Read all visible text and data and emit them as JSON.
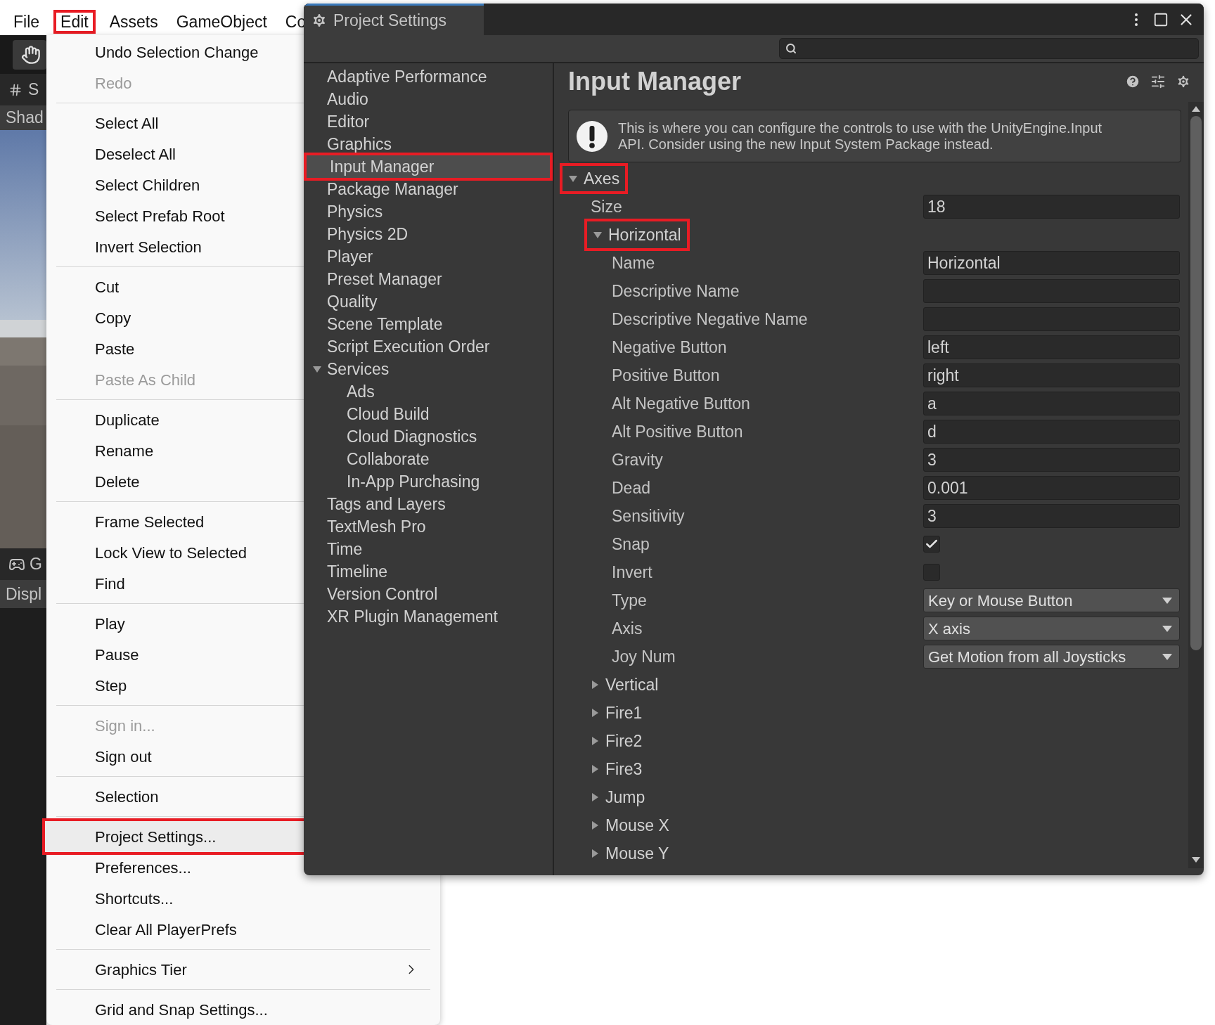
{
  "menu_bar": [
    {
      "label": "File",
      "highlighted": false
    },
    {
      "label": "Edit",
      "highlighted": true
    },
    {
      "label": "Assets",
      "highlighted": false
    },
    {
      "label": "GameObject",
      "highlighted": false
    },
    {
      "label": "Co",
      "highlighted": false
    }
  ],
  "editor_strip": {
    "scene_tab": "S",
    "scene_label": "Shad",
    "game_tab": "G",
    "game_label": "Displ"
  },
  "edit_menu": [
    [
      {
        "label": "Undo Selection Change",
        "kind": "command",
        "disabled": false,
        "highlighted": false
      },
      {
        "label": "Redo",
        "kind": "command",
        "disabled": true,
        "highlighted": false
      }
    ],
    [
      {
        "label": "Select All",
        "kind": "command",
        "disabled": false,
        "highlighted": false
      },
      {
        "label": "Deselect All",
        "kind": "command",
        "disabled": false,
        "highlighted": false
      },
      {
        "label": "Select Children",
        "kind": "command",
        "disabled": false,
        "highlighted": false
      },
      {
        "label": "Select Prefab Root",
        "kind": "command",
        "disabled": false,
        "highlighted": false
      },
      {
        "label": "Invert Selection",
        "kind": "command",
        "disabled": false,
        "highlighted": false
      }
    ],
    [
      {
        "label": "Cut",
        "kind": "command",
        "disabled": false,
        "highlighted": false
      },
      {
        "label": "Copy",
        "kind": "command",
        "disabled": false,
        "highlighted": false
      },
      {
        "label": "Paste",
        "kind": "command",
        "disabled": false,
        "highlighted": false
      },
      {
        "label": "Paste As Child",
        "kind": "command",
        "disabled": true,
        "highlighted": false
      }
    ],
    [
      {
        "label": "Duplicate",
        "kind": "command",
        "disabled": false,
        "highlighted": false
      },
      {
        "label": "Rename",
        "kind": "command",
        "disabled": false,
        "highlighted": false
      },
      {
        "label": "Delete",
        "kind": "command",
        "disabled": false,
        "highlighted": false
      }
    ],
    [
      {
        "label": "Frame Selected",
        "kind": "command",
        "disabled": false,
        "highlighted": false
      },
      {
        "label": "Lock View to Selected",
        "kind": "command",
        "disabled": false,
        "highlighted": false
      },
      {
        "label": "Find",
        "kind": "command",
        "disabled": false,
        "highlighted": false
      }
    ],
    [
      {
        "label": "Play",
        "kind": "command",
        "disabled": false,
        "highlighted": false
      },
      {
        "label": "Pause",
        "kind": "command",
        "disabled": false,
        "highlighted": false
      },
      {
        "label": "Step",
        "kind": "command",
        "disabled": false,
        "highlighted": false
      }
    ],
    [
      {
        "label": "Sign in...",
        "kind": "command",
        "disabled": true,
        "highlighted": false
      },
      {
        "label": "Sign out",
        "kind": "command",
        "disabled": false,
        "highlighted": false
      }
    ],
    [
      {
        "label": "Selection",
        "kind": "command",
        "disabled": false,
        "highlighted": false
      }
    ],
    [
      {
        "label": "Project Settings...",
        "kind": "command",
        "disabled": false,
        "highlighted": true
      },
      {
        "label": "Preferences...",
        "kind": "command",
        "disabled": false,
        "highlighted": false
      },
      {
        "label": "Shortcuts...",
        "kind": "command",
        "disabled": false,
        "highlighted": false
      },
      {
        "label": "Clear All PlayerPrefs",
        "kind": "command",
        "disabled": false,
        "highlighted": false
      }
    ],
    [
      {
        "label": "Graphics Tier",
        "kind": "submenu",
        "disabled": false,
        "highlighted": false
      }
    ],
    [
      {
        "label": "Grid and Snap Settings...",
        "kind": "command",
        "disabled": false,
        "highlighted": false
      }
    ]
  ],
  "window": {
    "title": "Project Settings"
  },
  "sidebar": {
    "items": [
      {
        "label": "Adaptive Performance",
        "selected": false,
        "highlighted": false
      },
      {
        "label": "Audio",
        "selected": false,
        "highlighted": false
      },
      {
        "label": "Editor",
        "selected": false,
        "highlighted": false
      },
      {
        "label": "Graphics",
        "selected": false,
        "highlighted": false
      },
      {
        "label": "Input Manager",
        "selected": true,
        "highlighted": true
      },
      {
        "label": "Package Manager",
        "selected": false,
        "highlighted": false
      },
      {
        "label": "Physics",
        "selected": false,
        "highlighted": false
      },
      {
        "label": "Physics 2D",
        "selected": false,
        "highlighted": false
      },
      {
        "label": "Player",
        "selected": false,
        "highlighted": false
      },
      {
        "label": "Preset Manager",
        "selected": false,
        "highlighted": false
      },
      {
        "label": "Quality",
        "selected": false,
        "highlighted": false
      },
      {
        "label": "Scene Template",
        "selected": false,
        "highlighted": false
      },
      {
        "label": "Script Execution Order",
        "selected": false,
        "highlighted": false
      },
      {
        "label": "Services",
        "selected": false,
        "highlighted": false,
        "expanded": true,
        "children": [
          {
            "label": "Ads",
            "selected": false,
            "highlighted": false
          },
          {
            "label": "Cloud Build",
            "selected": false,
            "highlighted": false
          },
          {
            "label": "Cloud Diagnostics",
            "selected": false,
            "highlighted": false
          },
          {
            "label": "Collaborate",
            "selected": false,
            "highlighted": false
          },
          {
            "label": "In-App Purchasing",
            "selected": false,
            "highlighted": false
          }
        ]
      },
      {
        "label": "Tags and Layers",
        "selected": false,
        "highlighted": false
      },
      {
        "label": "TextMesh Pro",
        "selected": false,
        "highlighted": false
      },
      {
        "label": "Time",
        "selected": false,
        "highlighted": false
      },
      {
        "label": "Timeline",
        "selected": false,
        "highlighted": false
      },
      {
        "label": "Version Control",
        "selected": false,
        "highlighted": false
      },
      {
        "label": "XR Plugin Management",
        "selected": false,
        "highlighted": false
      }
    ]
  },
  "inspector": {
    "title": "Input Manager",
    "help": "This is where you can configure the controls to use with the UnityEngine.Input API. Consider using the new Input System Package instead.",
    "axes": {
      "label": "Axes",
      "expanded": true,
      "highlighted": true,
      "size_label": "Size",
      "size": "18",
      "items": [
        {
          "label": "Horizontal",
          "expanded": true,
          "highlighted": true,
          "properties": [
            {
              "label": "Name",
              "kind": "text",
              "value": "Horizontal"
            },
            {
              "label": "Descriptive Name",
              "kind": "text"
            },
            {
              "label": "Descriptive Negative Name",
              "kind": "text"
            },
            {
              "label": "Negative Button",
              "kind": "text",
              "value": "left"
            },
            {
              "label": "Positive Button",
              "kind": "text",
              "value": "right"
            },
            {
              "label": "Alt Negative Button",
              "kind": "text",
              "value": "a"
            },
            {
              "label": "Alt Positive Button",
              "kind": "text",
              "value": "d"
            },
            {
              "label": "Gravity",
              "kind": "text",
              "value": "3"
            },
            {
              "label": "Dead",
              "kind": "text",
              "value": "0.001"
            },
            {
              "label": "Sensitivity",
              "kind": "text",
              "value": "3"
            },
            {
              "label": "Snap",
              "kind": "checkbox",
              "checked": true
            },
            {
              "label": "Invert",
              "kind": "checkbox",
              "checked": false
            },
            {
              "label": "Type",
              "kind": "dropdown",
              "value": "Key or Mouse Button"
            },
            {
              "label": "Axis",
              "kind": "dropdown",
              "value": "X axis"
            },
            {
              "label": "Joy Num",
              "kind": "dropdown",
              "value": "Get Motion from all Joysticks"
            }
          ]
        },
        {
          "label": "Vertical",
          "expanded": false,
          "highlighted": false
        },
        {
          "label": "Fire1",
          "expanded": false,
          "highlighted": false
        },
        {
          "label": "Fire2",
          "expanded": false,
          "highlighted": false
        },
        {
          "label": "Fire3",
          "expanded": false,
          "highlighted": false
        },
        {
          "label": "Jump",
          "expanded": false,
          "highlighted": false
        },
        {
          "label": "Mouse X",
          "expanded": false,
          "highlighted": false
        },
        {
          "label": "Mouse Y",
          "expanded": false,
          "highlighted": false
        }
      ]
    }
  }
}
